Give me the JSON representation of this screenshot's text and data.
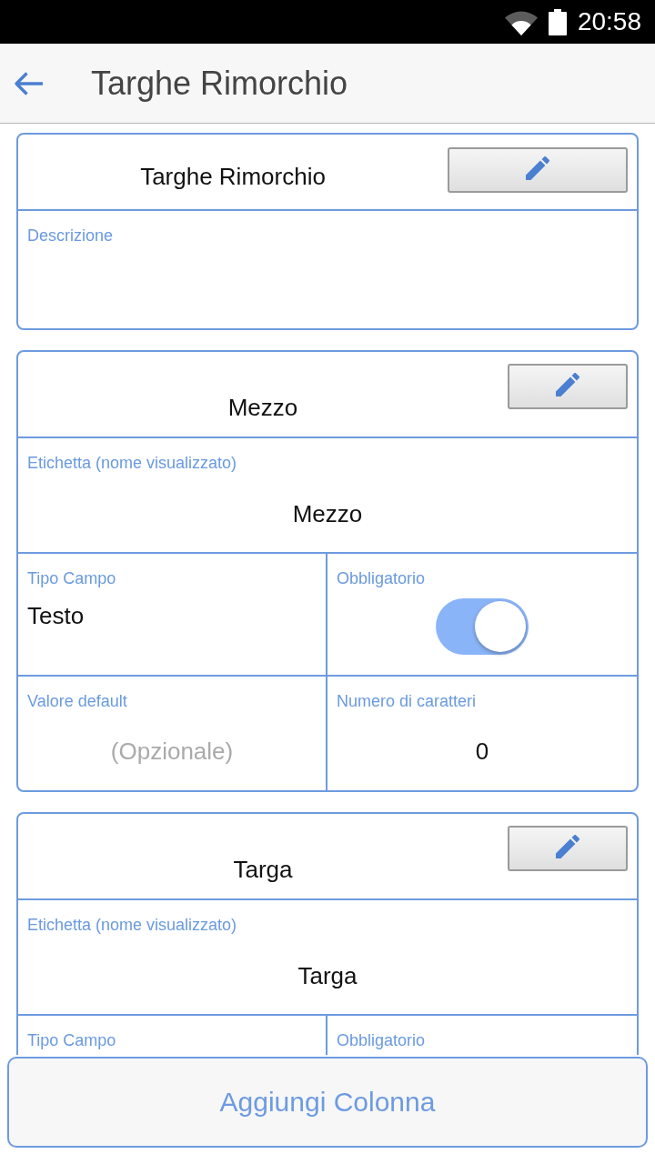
{
  "status_bar": {
    "time": "20:58"
  },
  "app_bar": {
    "title": "Targhe Rimorchio"
  },
  "table": {
    "name": "Targhe Rimorchio",
    "description": {
      "label": "Descrizione"
    }
  },
  "columns": [
    {
      "name": "Mezzo",
      "display_name": {
        "caption": "Etichetta (nome visualizzato)",
        "value": "Mezzo"
      },
      "field_type": {
        "caption": "Tipo Campo",
        "value": "Testo"
      },
      "mandatory": {
        "caption": "Obbligatorio",
        "on": true
      },
      "default_value": {
        "caption": "Valore default",
        "placeholder": "(Opzionale)"
      },
      "max_length": {
        "caption": "Numero di caratteri",
        "value": "0"
      }
    },
    {
      "name": "Targa",
      "display_name": {
        "caption": "Etichetta (nome visualizzato)",
        "value": "Targa"
      },
      "field_type": {
        "caption": "Tipo Campo"
      },
      "mandatory": {
        "caption": "Obbligatorio"
      }
    }
  ],
  "add_button": {
    "label": "Aggiungi Colonna"
  }
}
